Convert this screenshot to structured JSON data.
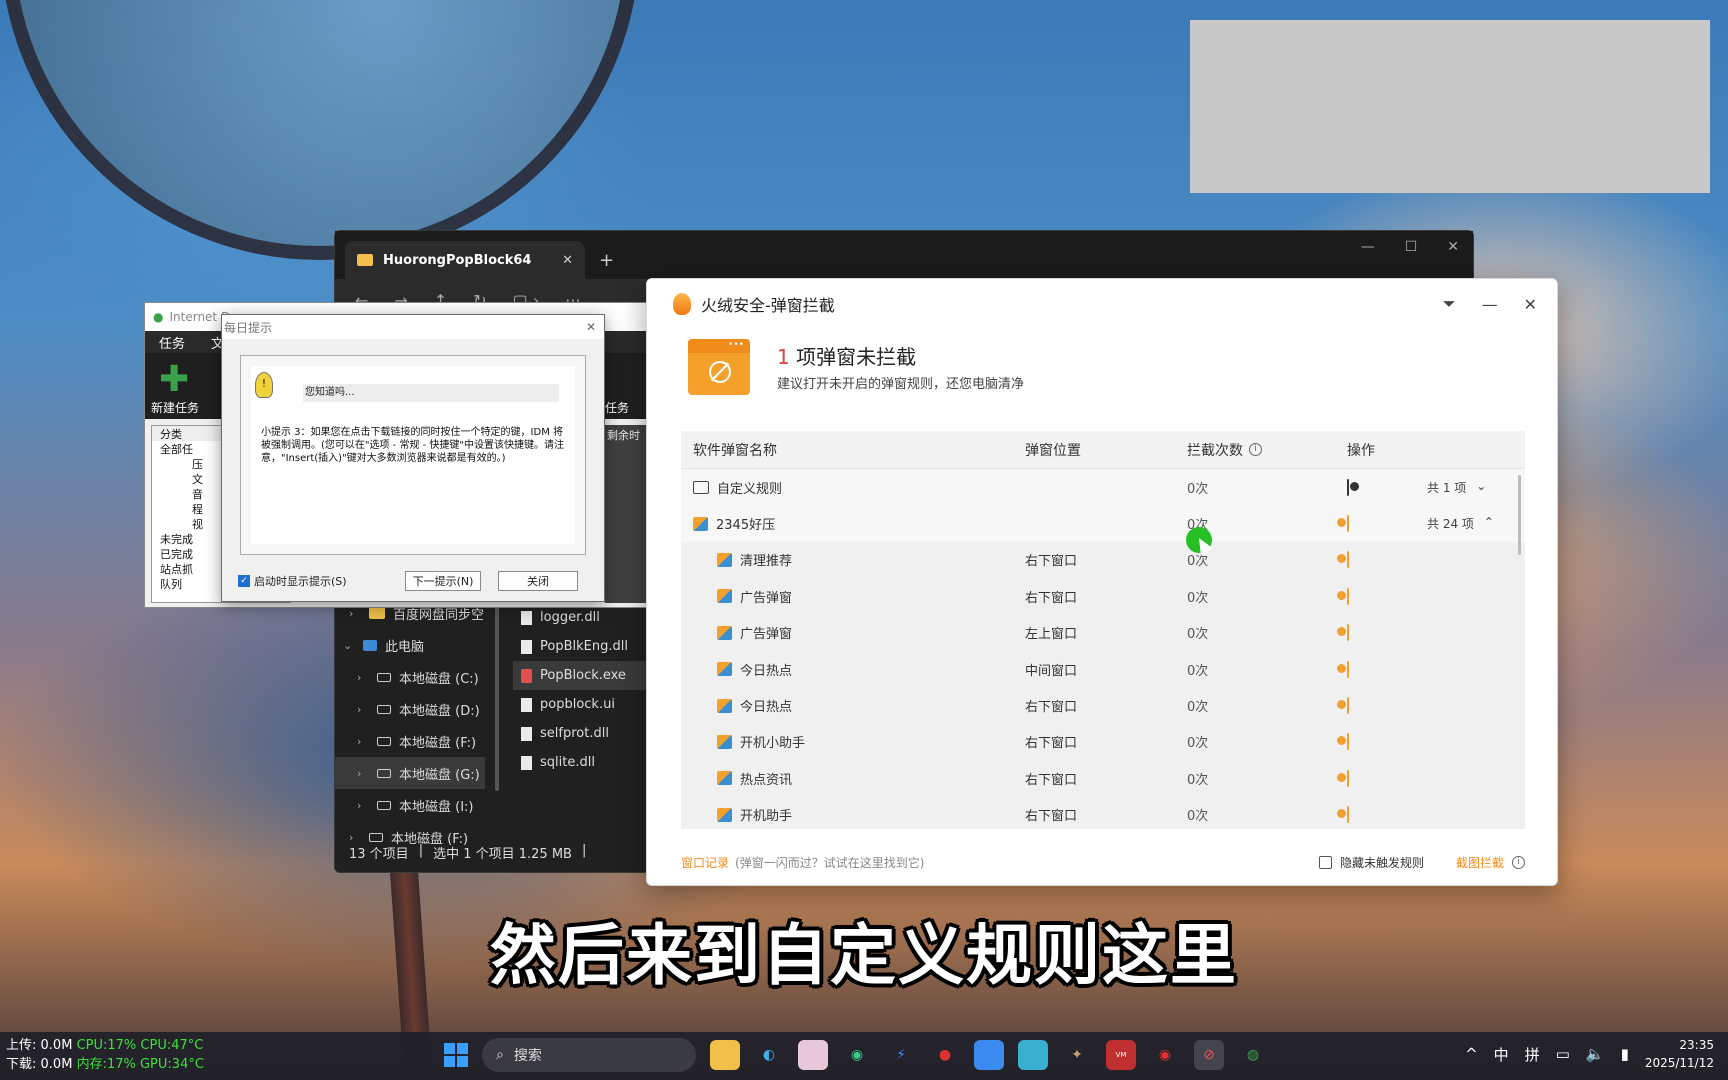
{
  "colors": {
    "accent": "#f08c1a",
    "alert": "#e04040",
    "toggle_on": "#f0a030"
  },
  "explorer": {
    "tab_title": "HuorongPopBlock64",
    "close": "✕",
    "new_tab": "+",
    "sidebar": [
      {
        "label": "百度网盘同步空",
        "icon": "folder-icon"
      },
      {
        "label": "此电脑",
        "icon": "pc-icon",
        "expanded": true
      },
      {
        "label": "本地磁盘 (C:)",
        "icon": "drive-icon"
      },
      {
        "label": "本地磁盘 (D:)",
        "icon": "drive-icon"
      },
      {
        "label": "本地磁盘 (F:)",
        "icon": "drive-icon"
      },
      {
        "label": "本地磁盘 (G:)",
        "icon": "drive-icon",
        "selected": true
      },
      {
        "label": "本地磁盘 (I:)",
        "icon": "drive-icon"
      },
      {
        "label": "本地磁盘 (F:)",
        "icon": "drive-icon"
      }
    ],
    "files": [
      {
        "name": "logger.dll"
      },
      {
        "name": "PopBlkEng.dll"
      },
      {
        "name": "PopBlock.exe",
        "selected": true
      },
      {
        "name": "popblock.ui"
      },
      {
        "name": "selfprot.dll"
      },
      {
        "name": "sqlite.dll"
      }
    ],
    "status_count": "13 个项目",
    "status_selected": "选中 1 个项目  1.25 MB"
  },
  "idm": {
    "title": "Internet D",
    "menu": [
      "任务",
      "文"
    ],
    "new_task": "新建任务",
    "task_label": "任务",
    "tree_header": "分类",
    "tree": [
      "全部任",
      "压",
      "文",
      "音",
      "程",
      "视",
      "未完成",
      "已完成",
      "站点抓",
      "队列"
    ],
    "grid_header": "剩余时"
  },
  "tip": {
    "title": "每日提示",
    "close": "✕",
    "heading": "您知道吗...",
    "body": "小提示 3：如果您在点击下载链接的同时按住一个特定的键，IDM 将被强制调用。(您可以在\"选项 - 常规 - 快捷键\"中设置该快捷键。请注意，\"Insert(插入)\"键对大多数浏览器来说都是有效的。)",
    "checkbox_label": "启动时显示提示(S)",
    "next_button": "下一提示(N)",
    "close_button": "关闭"
  },
  "huorong": {
    "title": "火绒安全-弹窗拦截",
    "count": "1",
    "count_text": " 项弹窗未拦截",
    "subtitle": "建议打开未开启的弹窗规则，还您电脑清净",
    "columns": {
      "name": "软件弹窗名称",
      "position": "弹窗位置",
      "count": "拦截次数",
      "action": "操作"
    },
    "groups": [
      {
        "name": "自定义规则",
        "count": "0次",
        "enabled": false,
        "total": "共 1 项",
        "expanded": false,
        "icon": "rule-icon"
      },
      {
        "name": "2345好压",
        "count": "0次",
        "enabled": true,
        "total": "共 24 项",
        "expanded": true,
        "icon": "app-icon"
      }
    ],
    "rows": [
      {
        "name": "清理推荐",
        "position": "右下窗口",
        "count": "0次",
        "enabled": true
      },
      {
        "name": "广告弹窗",
        "position": "右下窗口",
        "count": "0次",
        "enabled": true
      },
      {
        "name": "广告弹窗",
        "position": "左上窗口",
        "count": "0次",
        "enabled": true
      },
      {
        "name": "今日热点",
        "position": "中间窗口",
        "count": "0次",
        "enabled": true
      },
      {
        "name": "今日热点",
        "position": "右下窗口",
        "count": "0次",
        "enabled": true
      },
      {
        "name": "开机小助手",
        "position": "右下窗口",
        "count": "0次",
        "enabled": true
      },
      {
        "name": "热点资讯",
        "position": "右下窗口",
        "count": "0次",
        "enabled": true
      },
      {
        "name": "开机助手",
        "position": "右下窗口",
        "count": "0次",
        "enabled": true
      }
    ],
    "footer_link": "窗口记录",
    "footer_hint": "(弹窗一闪而过？试试在这里找到它)",
    "hide_label": "隐藏未触发规则",
    "screenshot_block": "截图拦截"
  },
  "subtitle": "然后来到自定义规则这里",
  "taskbar": {
    "upload": "上传:",
    "upload_value": "0.0M",
    "cpu": "CPU:17%",
    "cpu_temp": "CPU:47°C",
    "download": "下载:",
    "download_value": "0.0M",
    "mem": "内存:17%",
    "gpu_temp": "GPU:34°C",
    "search_placeholder": "搜索",
    "ime1": "中",
    "ime2": "拼",
    "time": "23:35",
    "date": "2025/11/12"
  }
}
